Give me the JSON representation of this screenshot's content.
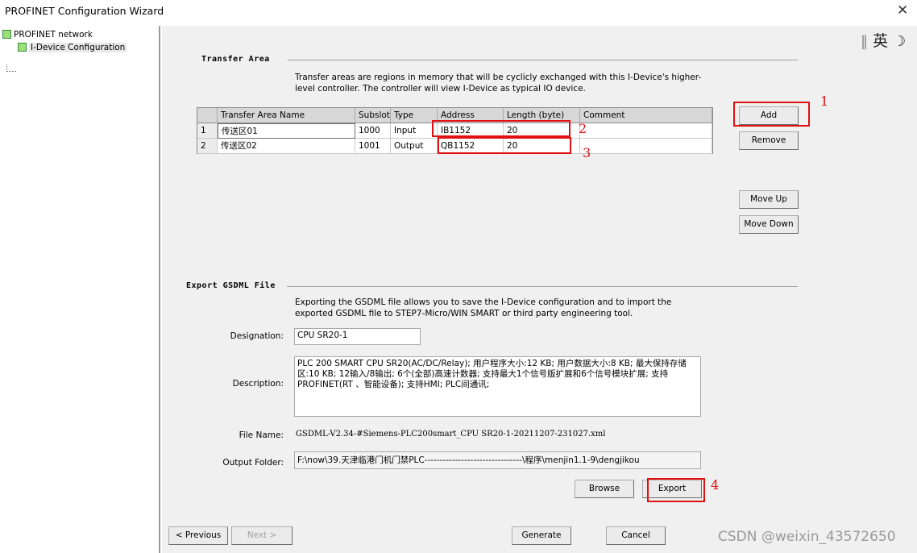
{
  "window": {
    "title": "PROFINET Configuration Wizard",
    "close_glyph": "✕"
  },
  "tree": {
    "root": {
      "label": "PROFINET network",
      "icon": "green-square-icon"
    },
    "child": {
      "label": "I-Device Configuration",
      "icon": "green-square-icon"
    }
  },
  "ime": {
    "separator": "‖",
    "lang": "英",
    "moon": "☽"
  },
  "transfer_area": {
    "heading": "Transfer Area",
    "description": "Transfer areas are regions in memory that will be cyclicly exchanged with this I-Device's higher-level controller.  The  controller will view I-Device as typical IO device.",
    "columns": [
      "Transfer Area Name",
      "Subslot",
      "Type",
      "Address",
      "Length (byte)",
      "Comment"
    ],
    "rows": [
      {
        "num": "1",
        "name": "传送区01",
        "subslot": "1000",
        "type": "Input",
        "address": "IB1152",
        "length": "20",
        "comment": ""
      },
      {
        "num": "2",
        "name": "传送区02",
        "subslot": "1001",
        "type": "Output",
        "address": "QB1152",
        "length": "20",
        "comment": ""
      }
    ],
    "buttons": {
      "add": "Add",
      "remove": "Remove",
      "move_up": "Move Up",
      "move_down": "Move Down"
    }
  },
  "export": {
    "heading": "Export GSDML File",
    "description": "Exporting the GSDML file allows you to save the I-Device configuration and to import the exported GSDML file to STEP7-Micro/WIN SMART or third party engineering tool.",
    "designation_label": "Designation:",
    "designation_value": "CPU SR20-1",
    "description_label": "Description:",
    "description_value": "PLC 200 SMART CPU SR20(AC/DC/Relay); 用户程序大小:12 KB; 用户数据大小:8 KB; 最大保持存储区:10 KB; 12输入/8输出; 6个(全部)高速计数器; 支持最大1个信号版扩展和6个信号模块扩展; 支持PROFINET(RT 、智能设备); 支持HMI; PLC间通讯;",
    "filename_label": "File Name:",
    "filename_value": "GSDML-V2.34-#Siemens-PLC200smart_CPU SR20-1-20211207-231027.xml",
    "folder_label": "Output Folder:",
    "folder_value": "F:\\now\\39.天津临港门机门禁PLC--------------------------------\\程序\\menjin1.1-9\\dengjikou",
    "browse": "Browse",
    "export": "Export"
  },
  "footer": {
    "previous": "< Previous",
    "next": "Next >",
    "generate": "Generate",
    "cancel": "Cancel"
  },
  "annotations": [
    "1",
    "2",
    "3",
    "4"
  ],
  "watermark": "CSDN @weixin_43572650",
  "colors": {
    "annotation_red": "#e01010",
    "tree_icon_green": "#9adf7a"
  }
}
